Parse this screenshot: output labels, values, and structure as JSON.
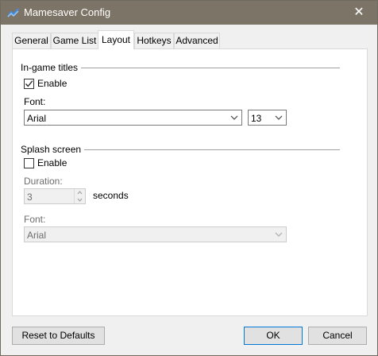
{
  "window": {
    "title": "Mamesaver Config",
    "close_glyph": "✕"
  },
  "tabs": [
    {
      "label": "General",
      "active": false
    },
    {
      "label": "Game List",
      "active": false
    },
    {
      "label": "Layout",
      "active": true
    },
    {
      "label": "Hotkeys",
      "active": false
    },
    {
      "label": "Advanced",
      "active": false
    }
  ],
  "in_game_titles": {
    "group_label": "In-game titles",
    "enable_label": "Enable",
    "enable_checked": true,
    "font_label": "Font:",
    "font_value": "Arial",
    "size_value": "13"
  },
  "splash_screen": {
    "group_label": "Splash screen",
    "enable_label": "Enable",
    "enable_checked": false,
    "duration_label": "Duration:",
    "duration_value": "3",
    "duration_unit": "seconds",
    "font_label": "Font:",
    "font_value": "Arial"
  },
  "buttons": {
    "reset": "Reset to Defaults",
    "ok": "OK",
    "cancel": "Cancel"
  },
  "colors": {
    "titlebar": "#7c7466",
    "accent": "#0078d7"
  }
}
